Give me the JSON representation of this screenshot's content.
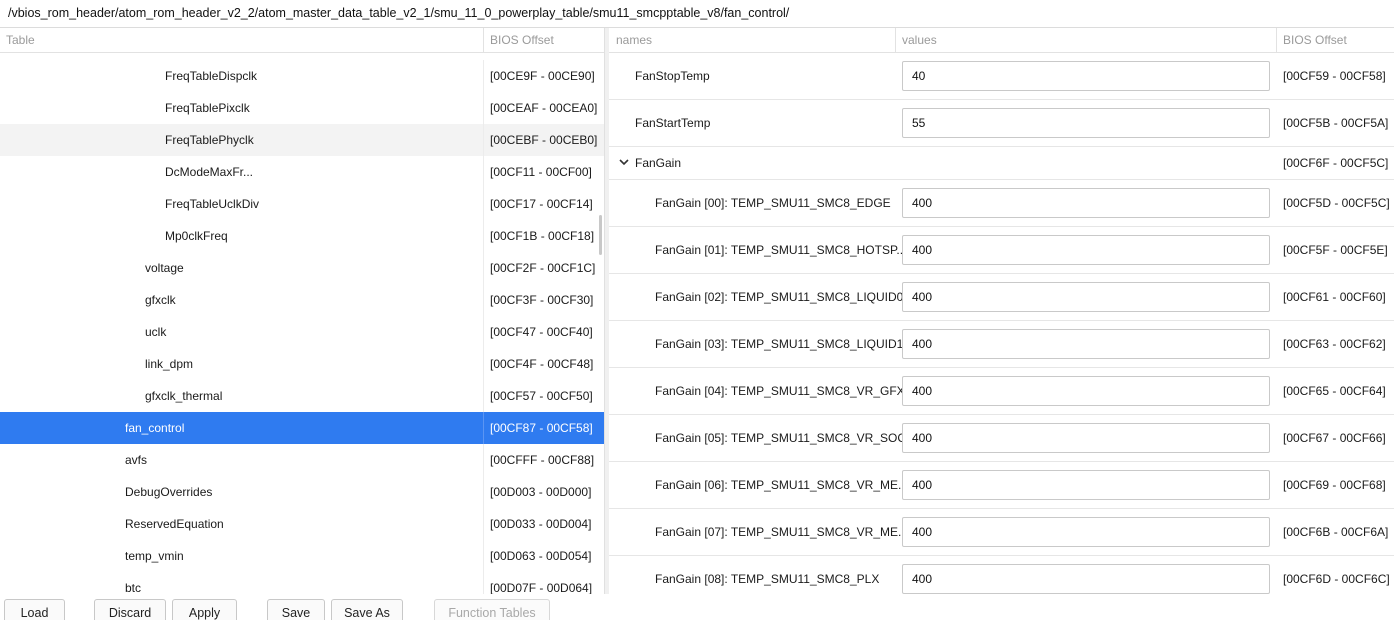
{
  "path": "/vbios_rom_header/atom_rom_header_v2_2/atom_master_data_table_v2_1/smu_11_0_powerplay_table/smu11_smcpptable_v8/fan_control/",
  "left_table": {
    "col_table": "Table",
    "col_offset": "BIOS Offset",
    "rows": [
      {
        "name": "FreqTableDispclk",
        "offset": "[00CE9F - 00CE90]",
        "state": "normal"
      },
      {
        "name": "FreqTablePixclk",
        "offset": "[00CEAF - 00CEA0]",
        "state": "normal"
      },
      {
        "name": "FreqTablePhyclk",
        "offset": "[00CEBF - 00CEB0]",
        "state": "hover"
      },
      {
        "name": "DcModeMaxFr...",
        "offset": "[00CF11 - 00CF00]",
        "state": "normal"
      },
      {
        "name": "FreqTableUclkDiv",
        "offset": "[00CF17 - 00CF14]",
        "state": "normal"
      },
      {
        "name": "Mp0clkFreq",
        "offset": "[00CF1B - 00CF18]",
        "state": "normal"
      },
      {
        "name": "voltage",
        "offset": "[00CF2F - 00CF1C]",
        "state": "normal"
      },
      {
        "name": "gfxclk",
        "offset": "[00CF3F - 00CF30]",
        "state": "normal"
      },
      {
        "name": "uclk",
        "offset": "[00CF47 - 00CF40]",
        "state": "normal"
      },
      {
        "name": "link_dpm",
        "offset": "[00CF4F - 00CF48]",
        "state": "normal"
      },
      {
        "name": "gfxclk_thermal",
        "offset": "[00CF57 - 00CF50]",
        "state": "normal"
      },
      {
        "name": "fan_control",
        "offset": "[00CF87 - 00CF58]",
        "state": "selected"
      },
      {
        "name": "avfs",
        "offset": "[00CFFF - 00CF88]",
        "state": "normal"
      },
      {
        "name": "DebugOverrides",
        "offset": "[00D003 - 00D000]",
        "state": "normal"
      },
      {
        "name": "ReservedEquation",
        "offset": "[00D033 - 00D004]",
        "state": "normal"
      },
      {
        "name": "temp_vmin",
        "offset": "[00D063 - 00D054]",
        "state": "normal"
      },
      {
        "name": "btc",
        "offset": "[00D07F - 00D064]",
        "state": "normal"
      }
    ]
  },
  "right_table": {
    "col_names": "names",
    "col_values": "values",
    "col_offset": "BIOS Offset",
    "fan_stop": {
      "name": "FanStopTemp",
      "value": "40",
      "offset": "[00CF59 - 00CF58]"
    },
    "fan_start": {
      "name": "FanStartTemp",
      "value": "55",
      "offset": "[00CF5B - 00CF5A]"
    },
    "fan_gain": {
      "name": "FanGain",
      "offset": "[00CF6F - 00CF5C]",
      "expanded": true
    },
    "gains": [
      {
        "name": "FanGain [00]: TEMP_SMU11_SMC8_EDGE",
        "value": "400",
        "offset": "[00CF5D - 00CF5C]"
      },
      {
        "name": "FanGain [01]: TEMP_SMU11_SMC8_HOTSP...",
        "value": "400",
        "offset": "[00CF5F - 00CF5E]"
      },
      {
        "name": "FanGain [02]: TEMP_SMU11_SMC8_LIQUID0",
        "value": "400",
        "offset": "[00CF61 - 00CF60]"
      },
      {
        "name": "FanGain [03]: TEMP_SMU11_SMC8_LIQUID1",
        "value": "400",
        "offset": "[00CF63 - 00CF62]"
      },
      {
        "name": "FanGain [04]: TEMP_SMU11_SMC8_VR_GFX",
        "value": "400",
        "offset": "[00CF65 - 00CF64]"
      },
      {
        "name": "FanGain [05]: TEMP_SMU11_SMC8_VR_SOC",
        "value": "400",
        "offset": "[00CF67 - 00CF66]"
      },
      {
        "name": "FanGain [06]: TEMP_SMU11_SMC8_VR_ME...",
        "value": "400",
        "offset": "[00CF69 - 00CF68]"
      },
      {
        "name": "FanGain [07]: TEMP_SMU11_SMC8_VR_ME...",
        "value": "400",
        "offset": "[00CF6B - 00CF6A]"
      },
      {
        "name": "FanGain [08]: TEMP_SMU11_SMC8_PLX",
        "value": "400",
        "offset": "[00CF6D - 00CF6C]"
      }
    ]
  },
  "buttons": {
    "load": "Load",
    "discard": "Discard",
    "apply": "Apply",
    "save": "Save",
    "save_as": "Save As",
    "function_tables": "Function Tables"
  },
  "icons": {
    "expand": "chevron-down-icon"
  },
  "colors": {
    "selection": "#2f7bf0"
  }
}
